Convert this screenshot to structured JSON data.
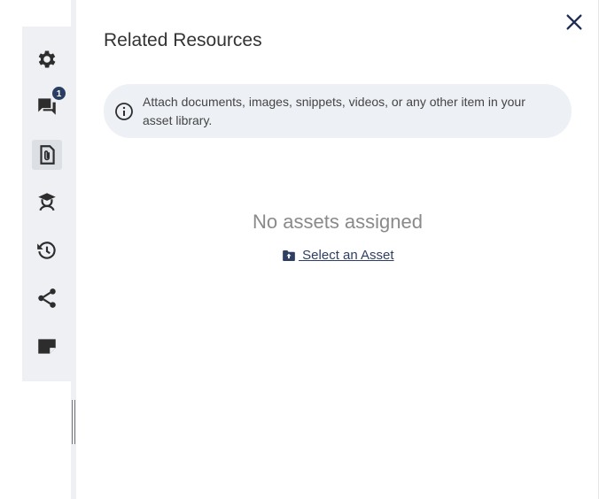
{
  "sidebar": {
    "items": [
      {
        "id": "settings",
        "icon": "gear-icon"
      },
      {
        "id": "comments",
        "icon": "comments-icon",
        "badge": "1"
      },
      {
        "id": "related-resources",
        "icon": "attachment-icon",
        "active": true
      },
      {
        "id": "training",
        "icon": "graduate-icon"
      },
      {
        "id": "history",
        "icon": "history-icon"
      },
      {
        "id": "share",
        "icon": "share-icon"
      },
      {
        "id": "notes",
        "icon": "note-icon"
      }
    ]
  },
  "panel": {
    "title": "Related Resources",
    "info_text": "Attach documents, images, snippets, videos, or any other item in your asset library.",
    "empty_title": "No assets assigned",
    "select_label": " Select an Asset"
  },
  "colors": {
    "rail_bg": "#eef0f3",
    "icon": "#2d2d2d",
    "badge": "#2a3e63",
    "close": "#1f2d52",
    "info_bg": "#edf0f5",
    "link": "#2f3f63"
  }
}
